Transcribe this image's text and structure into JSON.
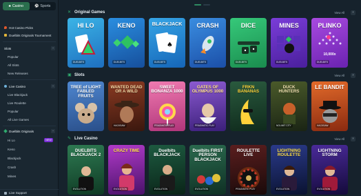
{
  "nav": {
    "tabs": [
      {
        "label": "Casino",
        "icon": "casino-icon",
        "active": true
      },
      {
        "label": "Sports",
        "icon": "sports-icon",
        "active": false
      }
    ]
  },
  "sidebar": {
    "promos": [
      {
        "label": "Hot Casino Picks",
        "icon": "fire-icon"
      },
      {
        "label": "Duelbits Originals Tournament",
        "icon": "trophy-icon"
      }
    ],
    "slots": {
      "label": "Slots",
      "items": [
        "Popular",
        "All Slots",
        "New Releases"
      ]
    },
    "live_casino": {
      "label": "Live Casino",
      "items": [
        "Live Blackjack",
        "Live Roulette",
        "Popular",
        "All Live Games"
      ]
    },
    "originals": {
      "label": "Duelbits Originals",
      "items": [
        {
          "label": "Hi Lo",
          "badge": "NEW"
        },
        {
          "label": "Keno"
        },
        {
          "label": "Blackjack"
        },
        {
          "label": "Crash"
        },
        {
          "label": "Mines"
        }
      ]
    },
    "live_support": "Live Support"
  },
  "sections": [
    {
      "title": "Original Games",
      "icon": "originals-icon",
      "view_all": "View All",
      "tiles": [
        {
          "title": "HI LO",
          "sub": "DUELBITS",
          "color": "#2f9fd8"
        },
        {
          "title": "KENO",
          "sub": "DUELBITS",
          "color": "#1f7fd0"
        },
        {
          "title": "BLACKJACK",
          "sub": "DUELBITS",
          "color": "#1e8fd4"
        },
        {
          "title": "CRASH",
          "sub": "DUELBITS",
          "color": "#2d78d8"
        },
        {
          "title": "DICE",
          "sub": "DUELBITS",
          "color": "#27b266"
        },
        {
          "title": "MINES",
          "sub": "DUELBITS",
          "color": "#6a34c8"
        },
        {
          "title": "PLINKO",
          "sub": "DUELBITS",
          "color": "#9b3ed8",
          "extra": "10,000x"
        }
      ]
    },
    {
      "title": "Slots",
      "icon": "slots-icon",
      "view_all": "View All",
      "tiles": [
        {
          "title": "TREE of LIGHT FABLED FRUITS",
          "sub": "",
          "color": "#3a6fb8"
        },
        {
          "title": "WANTED DEAD OR A WILD",
          "sub": "HACKSAW",
          "color": "#6b2b1c"
        },
        {
          "title": "SWEET BONANZA 1000",
          "sub": "PRAGMATIC PLAY",
          "color": "#c7508a"
        },
        {
          "title": "GATES OF OLYMPUS 1000",
          "sub": "PRAGMATIC PLAY",
          "color": "#6a3da8"
        },
        {
          "title": "FRKN BANANAS",
          "sub": "",
          "color": "#1a3a2a"
        },
        {
          "title": "DUCK HUNTERS",
          "sub": "NOLIMIT CITY",
          "color": "#2a3a22"
        },
        {
          "title": "LE BANDIT",
          "sub": "HACKSAW",
          "color": "#b44a1c"
        }
      ]
    },
    {
      "title": "Live Casino",
      "icon": "live-casino-icon",
      "view_all": "View All",
      "tiles": [
        {
          "title": "DUELBITS BLACKJACK 2",
          "sub": "EVOLUTION",
          "color": "#1f5a3a"
        },
        {
          "title": "CRAZY TIME",
          "sub": "EVOLUTION",
          "color": "#7a1f8a"
        },
        {
          "title": "Duelbits BLACKJACK",
          "sub": "EVOLUTION",
          "color": "#0f3a2a"
        },
        {
          "title": "Duelbits FIRST PERSON BLACKJACK",
          "sub": "EVOLUTION",
          "color": "#1d4b3a"
        },
        {
          "title": "ROULETTE LIVE",
          "sub": "PRAGMATIC PLAY",
          "color": "#3a1a1a"
        },
        {
          "title": "LIGHTNING ROULETTE",
          "sub": "EVOLUTION",
          "color": "#1a2a5a"
        },
        {
          "title": "LIGHTNING STORM",
          "sub": "EVOLUTION",
          "color": "#2a1a5a"
        }
      ]
    }
  ]
}
